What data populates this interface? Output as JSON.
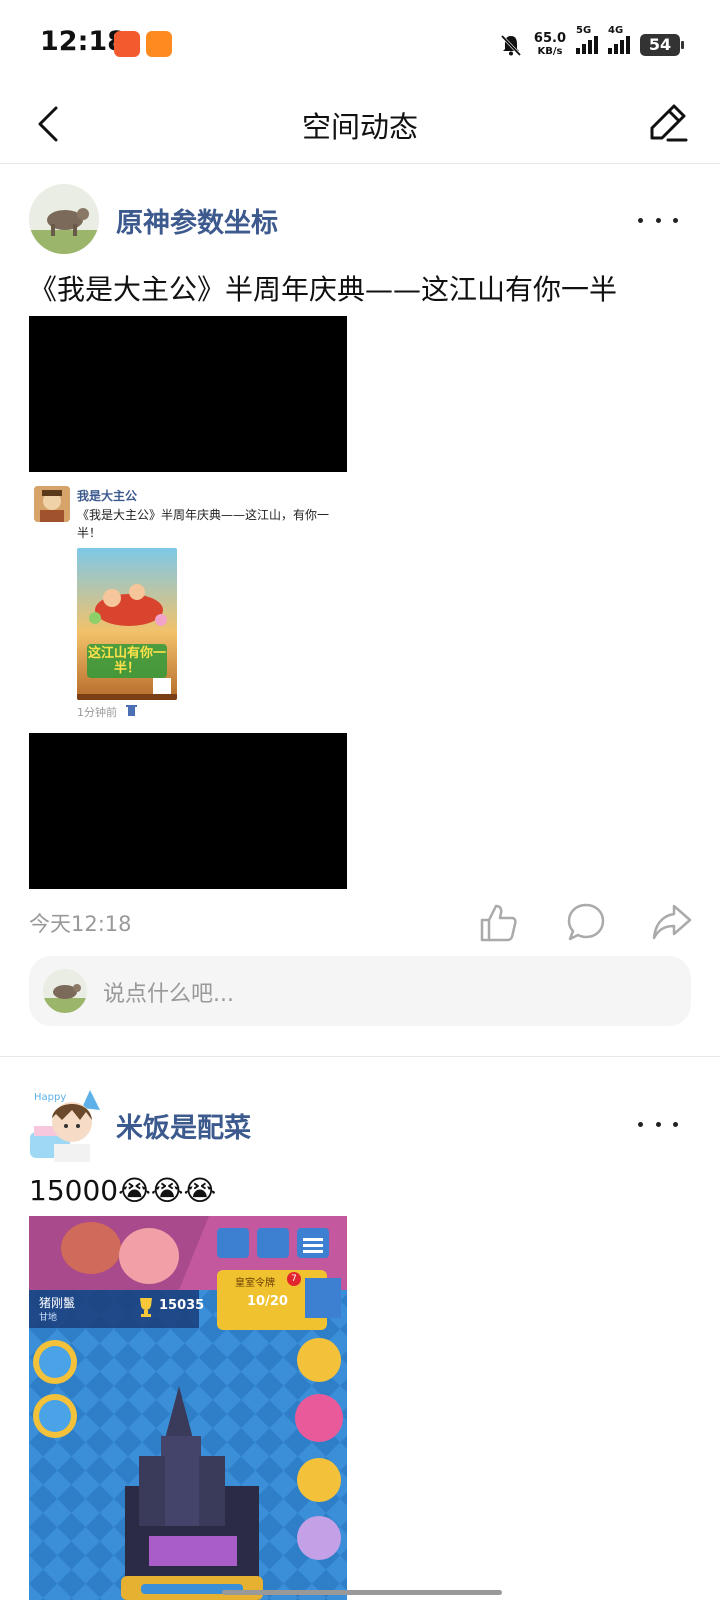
{
  "status": {
    "time": "12:18",
    "net_speed": "65.0",
    "net_unit": "KB/s",
    "sig1": "5G",
    "sig2": "4G",
    "battery": "54"
  },
  "header": {
    "title": "空间动态"
  },
  "posts": [
    {
      "username": "原神参数坐标",
      "text": "《我是大主公》半周年庆典——这江山有你一半",
      "embed": {
        "name": "我是大主公",
        "text": "《我是大主公》半周年庆典——这江山，有你一半！",
        "time": "1分钟前",
        "poster_title": "这江山有你一半！"
      },
      "time": "今天12:18",
      "comment_placeholder": "说点什么吧..."
    },
    {
      "username": "米饭是配菜",
      "text": "15000😭😭😭",
      "game": {
        "player": "猪刚鬣",
        "sub": "甘地",
        "trophies": "15035",
        "royal_label": "皇室令牌",
        "royal_progress": "10/20",
        "badge": "7"
      }
    }
  ]
}
